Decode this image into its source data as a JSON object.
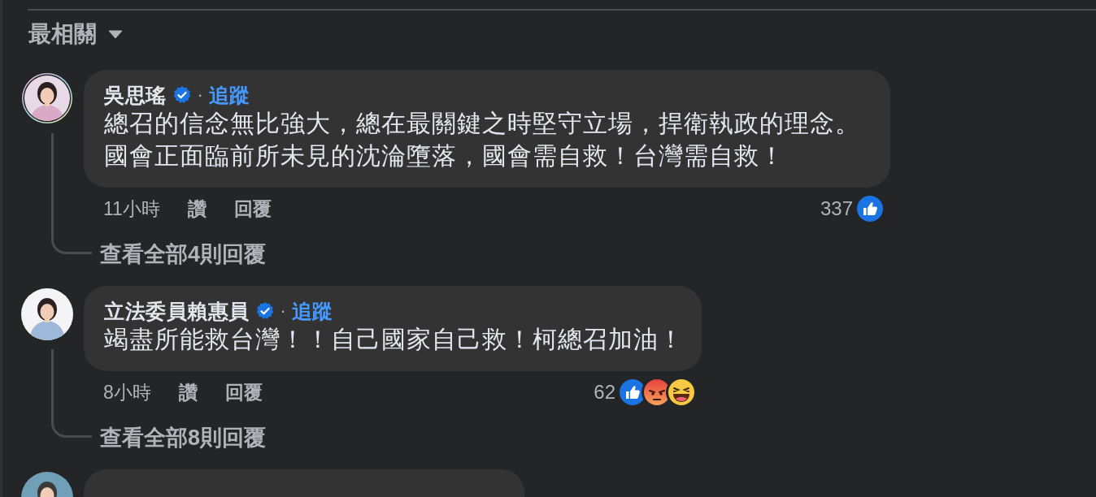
{
  "sort": {
    "label": "最相關"
  },
  "comments": [
    {
      "author": "吳思瑤",
      "story_ring": true,
      "verified": true,
      "separator": "·",
      "follow": "追蹤",
      "text": "總召的信念無比強大，總在最關鍵之時堅守立場，捍衛執政的理念。國會正面臨前所未見的沈淪墮落，國會需自救！台灣需自救！",
      "time": "11小時",
      "like": "讚",
      "reply": "回覆",
      "reaction_count": "337",
      "reactions": [
        {
          "kind": "like"
        }
      ],
      "replies": "查看全部4則回覆"
    },
    {
      "author": "立法委員賴惠員",
      "story_ring": false,
      "verified": true,
      "separator": "·",
      "follow": "追蹤",
      "text": "竭盡所能救台灣！！自己國家自己救！柯總召加油！",
      "time": "8小時",
      "like": "讚",
      "reply": "回覆",
      "reaction_count": "62",
      "reactions": [
        {
          "kind": "like"
        },
        {
          "kind": "angry"
        },
        {
          "kind": "haha"
        }
      ],
      "replies": "查看全部8則回覆"
    },
    {
      "story_ring": false
    }
  ]
}
